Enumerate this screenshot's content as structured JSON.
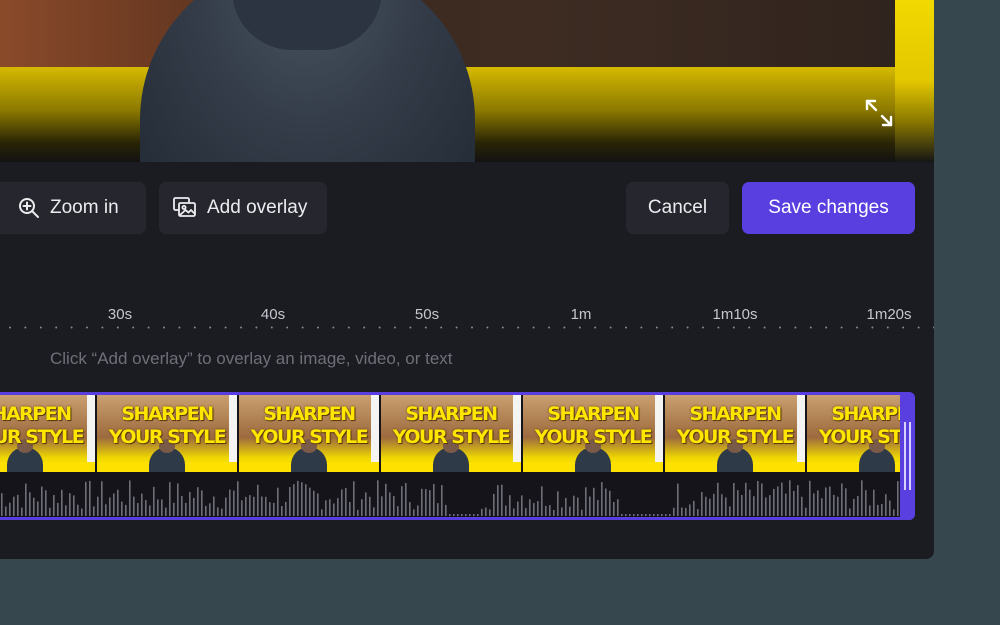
{
  "toolbar": {
    "zoom_in_label": "Zoom in",
    "add_overlay_label": "Add overlay",
    "cancel_label": "Cancel",
    "save_label": "Save changes"
  },
  "ruler": {
    "ticks": [
      "30s",
      "40s",
      "50s",
      "1m",
      "1m10s",
      "1m20s"
    ]
  },
  "overlay_hint": "Click “Add overlay” to overlay an image, video, or text",
  "thumbnail_text": {
    "line1": "SHARPEN",
    "line2": "YOUR STYLE"
  },
  "colors": {
    "accent": "#5a3fe0",
    "panel": "#1b1b22",
    "button": "#26262e",
    "background": "#36474d",
    "thumbnail_yellow": "#ffe600"
  },
  "icons": {
    "zoom": "zoom-in-icon",
    "overlay": "overlay-icon",
    "expand": "expand-icon"
  }
}
